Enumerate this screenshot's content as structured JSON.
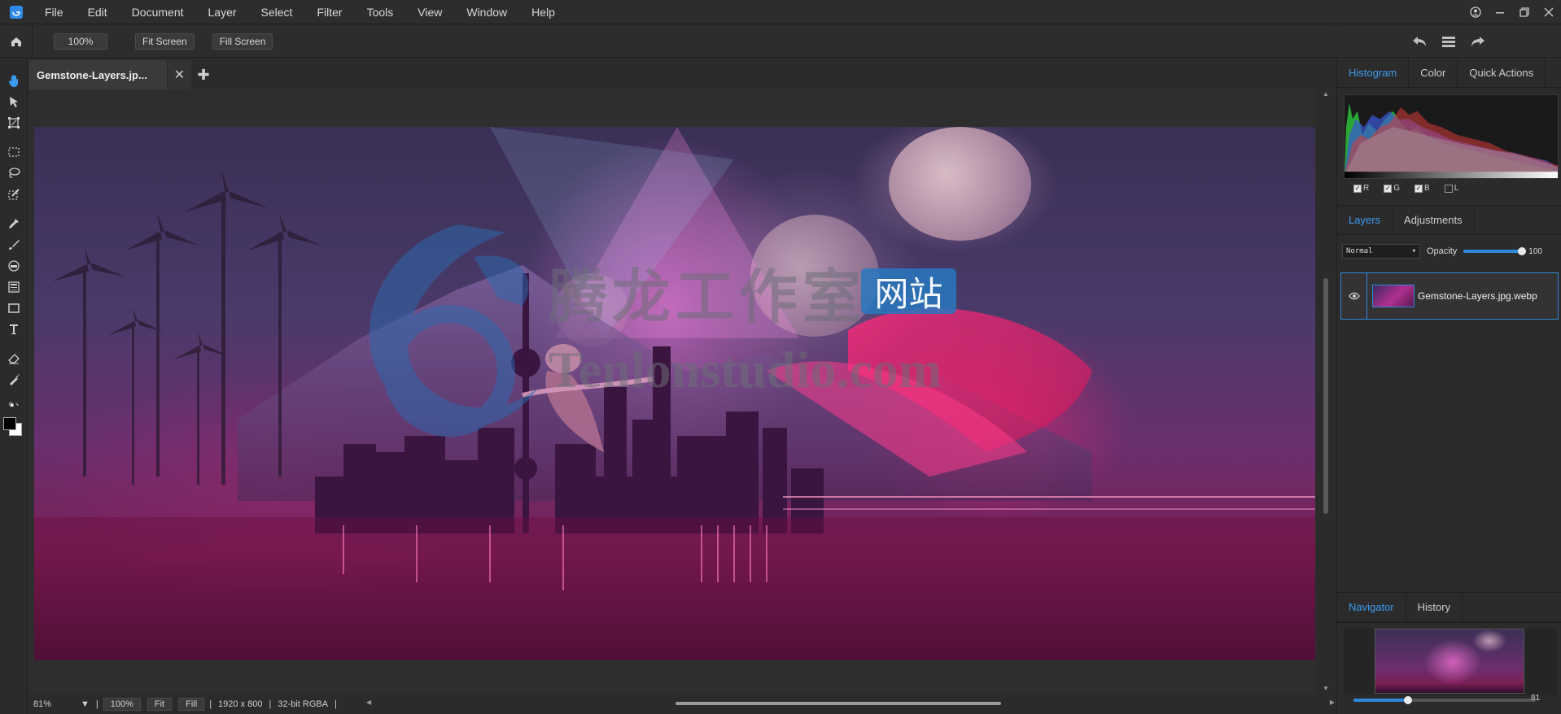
{
  "menubar": {
    "items": [
      "File",
      "Edit",
      "Document",
      "Layer",
      "Select",
      "Filter",
      "Tools",
      "View",
      "Window",
      "Help"
    ],
    "window_controls": [
      "user-icon",
      "minimize-icon",
      "restore-icon",
      "close-icon"
    ]
  },
  "optionsbar": {
    "zoom": "100%",
    "fit_screen": "Fit Screen",
    "fill_screen": "Fill Screen"
  },
  "panel_top_icons": [
    "undo-icon",
    "menu-icon",
    "redo-icon"
  ],
  "document": {
    "tab_title": "Gemstone-Layers.jp...",
    "watermark_cn": "腾龙工作室",
    "watermark_badge": "网站",
    "watermark_url": "Tenlonstudio.com"
  },
  "statusbar": {
    "zoom": "81%",
    "btn_100": "100%",
    "btn_fit": "Fit",
    "btn_fill": "Fill",
    "dimensions": "1920 x 800",
    "mode": "32-bit RGBA"
  },
  "histogram_panel": {
    "tabs": [
      "Histogram",
      "Color",
      "Quick Actions"
    ],
    "channels": [
      {
        "label": "R",
        "checked": true
      },
      {
        "label": "G",
        "checked": true
      },
      {
        "label": "B",
        "checked": true
      },
      {
        "label": "L",
        "checked": false
      }
    ]
  },
  "layers_panel": {
    "tabs": [
      "Layers",
      "Adjustments"
    ],
    "blend_mode": "Normal",
    "opacity_label": "Opacity",
    "opacity_value": "100",
    "opacity_fraction": 1.0,
    "layer_name": "Gemstone-Layers.jpg.webp"
  },
  "navigator_panel": {
    "tabs": [
      "Navigator",
      "History"
    ],
    "zoom_value": "81",
    "zoom_fraction": 0.3
  },
  "colors": {
    "accent": "#2f88dc",
    "tab_active": "#3d9bef"
  }
}
